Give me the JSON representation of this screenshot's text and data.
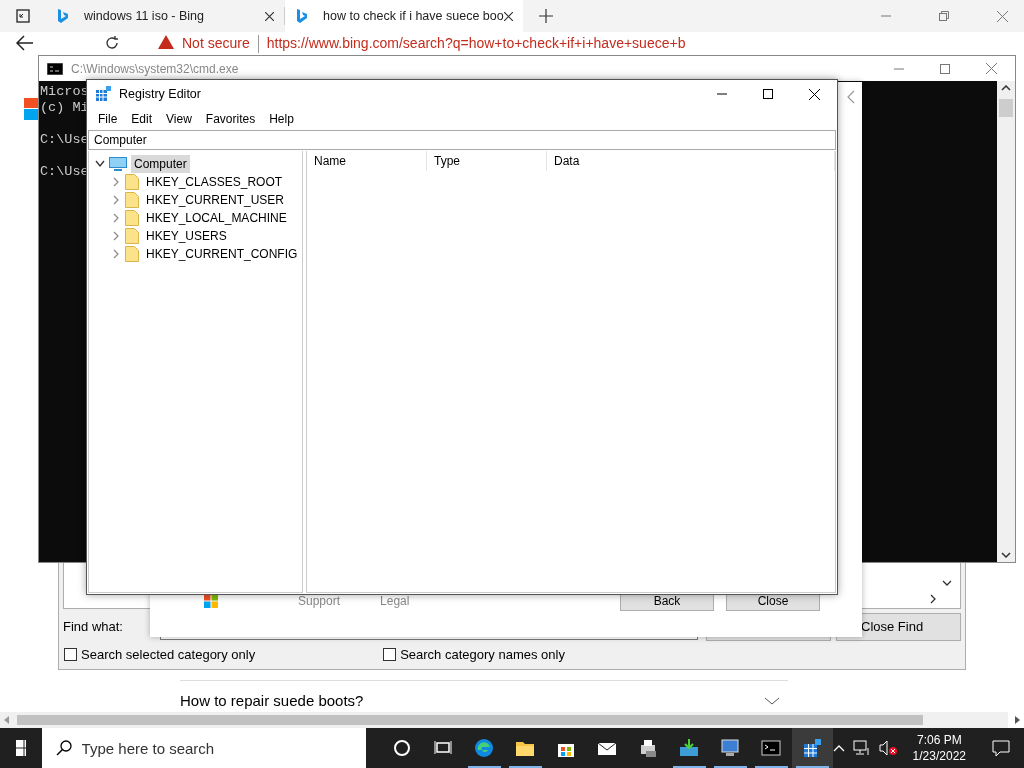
{
  "browser": {
    "tabs": [
      {
        "label": "windows 11 iso - Bing",
        "selected": false
      },
      {
        "label": "how to check if i have suece boo",
        "selected": true
      }
    ],
    "security_label": "Not secure",
    "url": "https://www.bing.com/search?q=how+to+check+if+i+have+suece+b",
    "question": "How to repair suede boots?"
  },
  "find_dialog": {
    "label": "Find what:",
    "close_button": "Close Find",
    "options": [
      {
        "label": "Search selected category only",
        "checked": false
      },
      {
        "label": "Search category names only",
        "checked": false
      }
    ]
  },
  "cmd": {
    "title": "C:\\Windows\\system32\\cmd.exe",
    "blocks": [
      [
        "Micros",
        "(c) Mi"
      ],
      [
        "C:\\Use"
      ],
      [
        "C:\\Use"
      ]
    ]
  },
  "about_dialog": {
    "footer_links": [
      "Support",
      "Legal"
    ],
    "buttons": [
      "Back",
      "Close"
    ]
  },
  "regedit": {
    "title": "Registry Editor",
    "menu": [
      "File",
      "Edit",
      "View",
      "Favorites",
      "Help"
    ],
    "address": "Computer",
    "tree": [
      {
        "label": "Computer",
        "kind": "computer",
        "expanded": true,
        "selected": true,
        "children": [
          {
            "label": "HKEY_CLASSES_ROOT",
            "kind": "folder",
            "expanded": false,
            "selected": false
          },
          {
            "label": "HKEY_CURRENT_USER",
            "kind": "folder",
            "expanded": false,
            "selected": false
          },
          {
            "label": "HKEY_LOCAL_MACHINE",
            "kind": "folder",
            "expanded": false,
            "selected": false
          },
          {
            "label": "HKEY_USERS",
            "kind": "folder",
            "expanded": false,
            "selected": false
          },
          {
            "label": "HKEY_CURRENT_CONFIG",
            "kind": "folder",
            "expanded": false,
            "selected": false
          }
        ]
      }
    ],
    "columns": [
      "Name",
      "Type",
      "Data"
    ]
  },
  "taskbar": {
    "search_placeholder": "Type here to search",
    "time": "7:06 PM",
    "date": "1/23/2022",
    "apps": [
      {
        "kind": "cortana",
        "running": false,
        "selected": false
      },
      {
        "kind": "taskview",
        "running": false,
        "selected": false
      },
      {
        "kind": "edge",
        "running": true,
        "selected": false
      },
      {
        "kind": "explorer",
        "running": true,
        "selected": false
      },
      {
        "kind": "store",
        "running": false,
        "selected": false
      },
      {
        "kind": "mail",
        "running": false,
        "selected": false
      },
      {
        "kind": "printer",
        "running": false,
        "selected": false
      },
      {
        "kind": "download",
        "running": true,
        "selected": false
      },
      {
        "kind": "monitor",
        "running": true,
        "selected": false
      },
      {
        "kind": "console",
        "running": true,
        "selected": false
      },
      {
        "kind": "registry",
        "running": true,
        "selected": true
      }
    ]
  }
}
